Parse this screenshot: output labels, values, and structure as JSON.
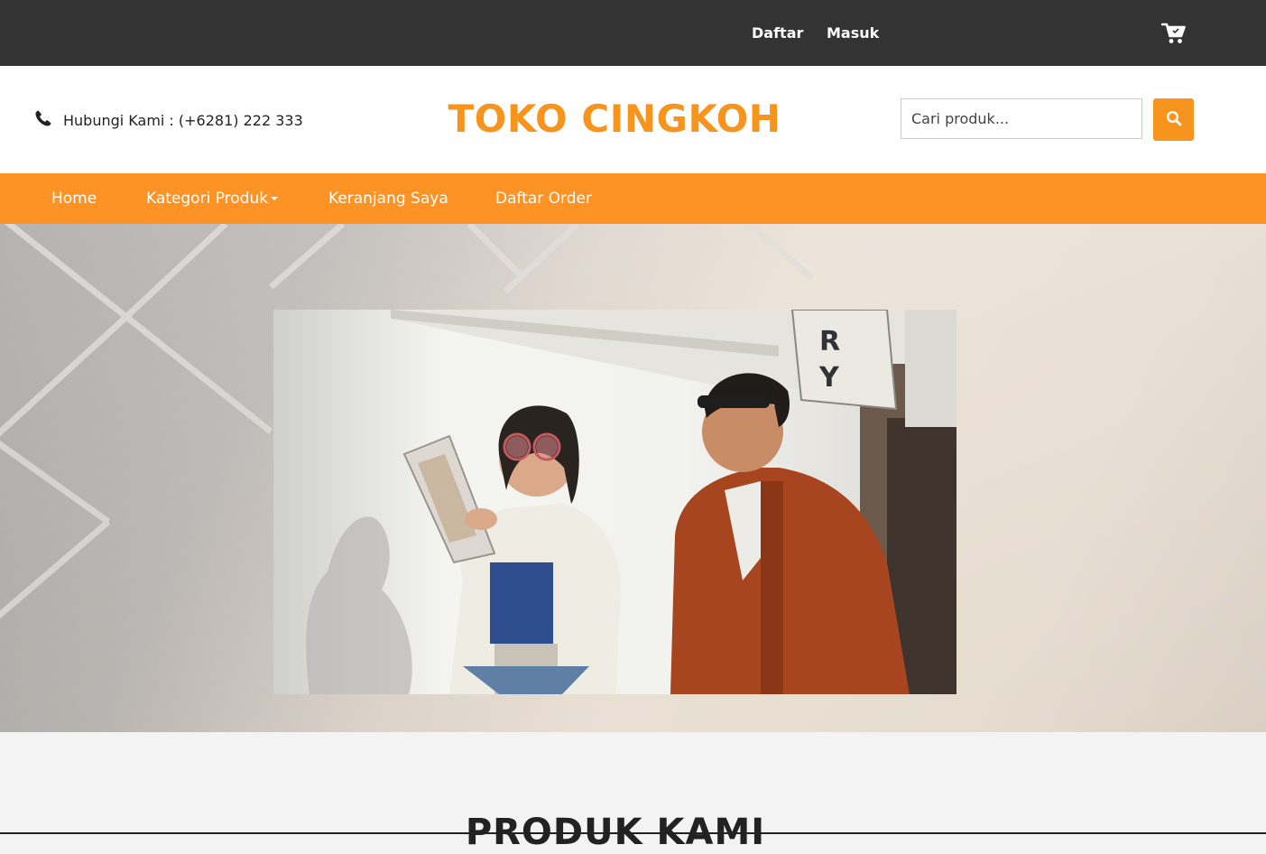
{
  "topbar": {
    "register_label": "Daftar",
    "login_label": "Masuk",
    "cart_icon": "cart-icon"
  },
  "header": {
    "contact_icon": "phone-icon",
    "contact_text": "Hubungi Kami : (+6281) 222 333",
    "brand": "TOKO CINGKOH",
    "search": {
      "placeholder": "Cari produk...",
      "value": "",
      "button_icon": "search-icon"
    }
  },
  "nav": {
    "items": [
      {
        "label": "Home"
      },
      {
        "label": "Kategori Produk"
      },
      {
        "label": "Keranjang Saya"
      },
      {
        "label": "Daftar Order"
      }
    ]
  },
  "products": {
    "heading": "PRODUK KAMI"
  },
  "colors": {
    "topbar": "#333333",
    "accent": "#fd9324",
    "brand_text": "#f7941d",
    "header_bg": "#ffffff",
    "section_bg": "#f3f3f3"
  }
}
